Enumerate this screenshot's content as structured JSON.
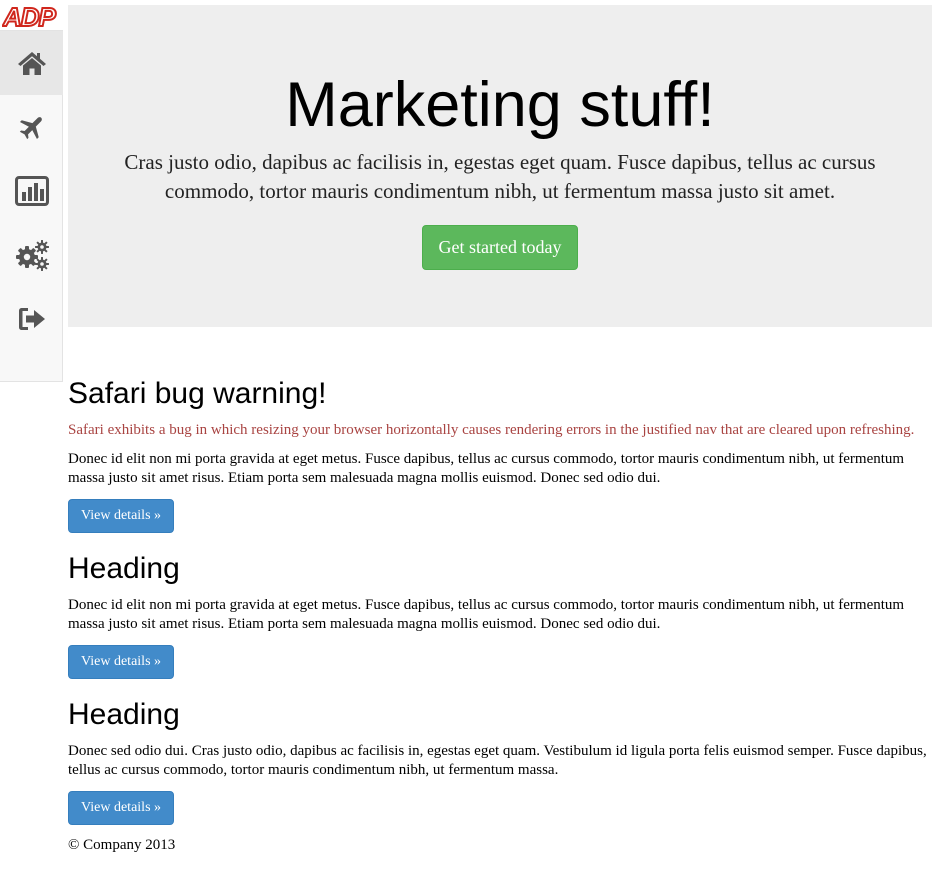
{
  "logo": {
    "text": "ADP",
    "color": "#d0271d"
  },
  "sidebar": {
    "items": [
      {
        "icon": "home-icon",
        "active": true
      },
      {
        "icon": "plane-icon",
        "active": false
      },
      {
        "icon": "bar-chart-icon",
        "active": false
      },
      {
        "icon": "gears-icon",
        "active": false
      },
      {
        "icon": "sign-out-icon",
        "active": false
      }
    ]
  },
  "jumbotron": {
    "title": "Marketing stuff!",
    "lead": "Cras justo odio, dapibus ac facilisis in, egestas eget quam. Fusce dapibus, tellus ac cursus commodo, tortor mauris condimentum nibh, ut fermentum massa justo sit amet.",
    "button": "Get started today"
  },
  "sections": [
    {
      "heading": "Safari bug warning!",
      "warning": "Safari exhibits a bug in which resizing your browser horizontally causes rendering errors in the justified nav that are cleared upon refreshing.",
      "body": "Donec id elit non mi porta gravida at eget metus. Fusce dapibus, tellus ac cursus commodo, tortor mauris condimentum nibh, ut fermentum massa justo sit amet risus. Etiam porta sem malesuada magna mollis euismod. Donec sed odio dui.",
      "button": "View details »"
    },
    {
      "heading": "Heading",
      "body": "Donec id elit non mi porta gravida at eget metus. Fusce dapibus, tellus ac cursus commodo, tortor mauris condimentum nibh, ut fermentum massa justo sit amet risus. Etiam porta sem malesuada magna mollis euismod. Donec sed odio dui.",
      "button": "View details »"
    },
    {
      "heading": "Heading",
      "body": "Donec sed odio dui. Cras justo odio, dapibus ac facilisis in, egestas eget quam. Vestibulum id ligula porta felis euismod semper. Fusce dapibus, tellus ac cursus commodo, tortor mauris condimentum nibh, ut fermentum massa.",
      "button": "View details »"
    }
  ],
  "footer": {
    "text": "© Company 2013"
  },
  "colors": {
    "jumbotron_bg": "#eeeeee",
    "success": "#5cb85c",
    "primary": "#428bca",
    "warning_text": "#a94442",
    "icon": "#555555"
  }
}
